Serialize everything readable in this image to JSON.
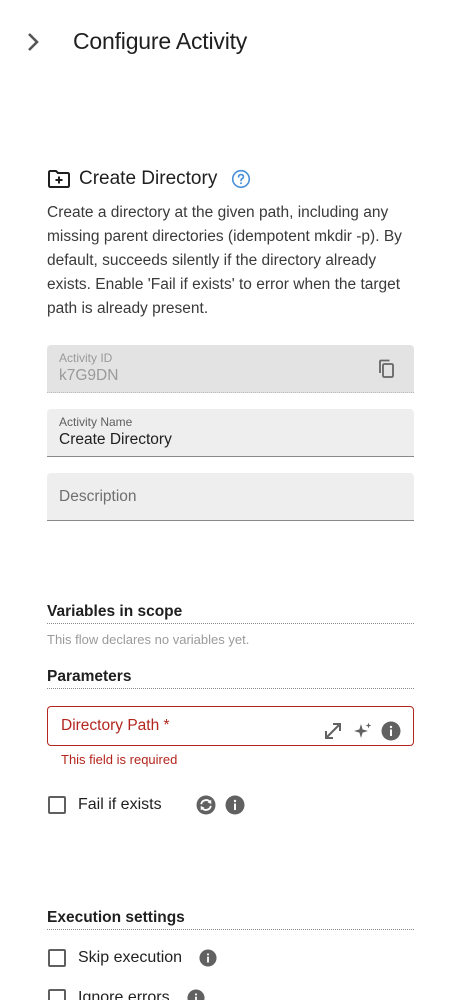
{
  "header": {
    "title": "Configure Activity"
  },
  "activity": {
    "title": "Create Directory",
    "description": "Create a directory at the given path, including any missing parent directories (idempotent mkdir -p). By default, succeeds silently if the directory already exists. Enable 'Fail if exists' to error when the target path is already present."
  },
  "fields": {
    "activity_id": {
      "label": "Activity ID",
      "value": "k7G9DN"
    },
    "activity_name": {
      "label": "Activity Name",
      "value": "Create Directory"
    },
    "description": {
      "placeholder": "Description"
    }
  },
  "variables": {
    "title": "Variables in scope",
    "note": "This flow declares no variables yet."
  },
  "parameters": {
    "title": "Parameters",
    "directory_path": {
      "label": "Directory Path *",
      "error": "This field is required"
    },
    "fail_if_exists": {
      "label": "Fail if exists",
      "checked": false
    }
  },
  "execution": {
    "title": "Execution settings",
    "skip_execution": {
      "label": "Skip execution",
      "checked": false
    },
    "ignore_errors": {
      "label": "Ignore errors",
      "checked": false
    }
  },
  "colors": {
    "accent": "#1976d2",
    "error": "#b3261e",
    "icon_gray": "#616161"
  },
  "icons": {
    "collapse": "chevron-right-icon",
    "folder": "create-folder-icon",
    "help": "help-circle-icon",
    "copy": "copy-icon",
    "expand": "expand-arrows-icon",
    "ai": "sparkle-icon",
    "info": "info-icon",
    "sync": "sync-icon"
  }
}
